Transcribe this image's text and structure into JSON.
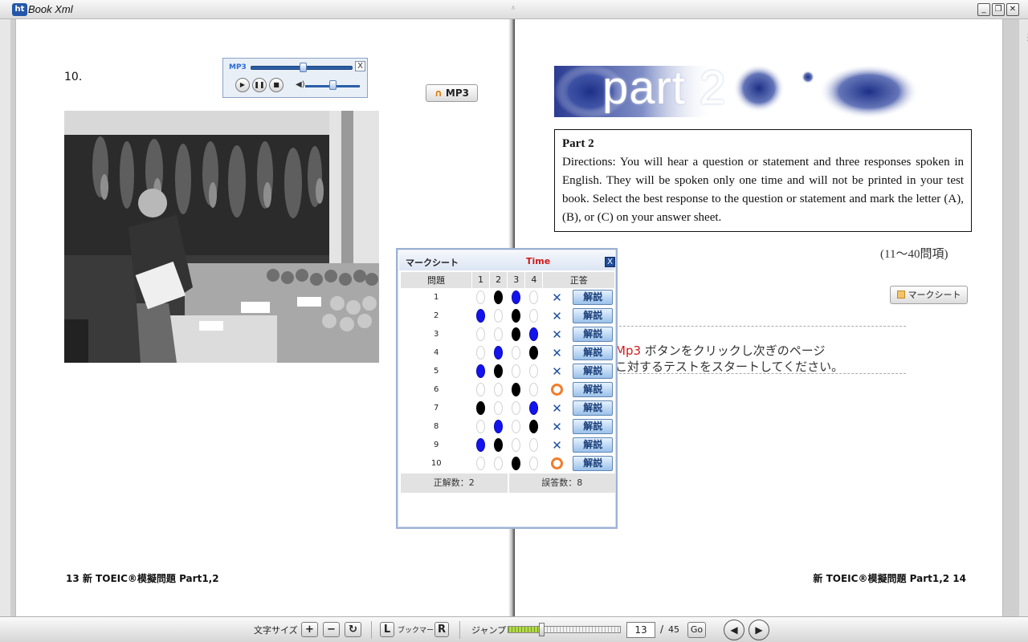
{
  "window": {
    "title": "Book Xml",
    "logo_text": "ht",
    "grip": "⩡",
    "minimize": "_",
    "restore": "❐",
    "close": "✕"
  },
  "left_page": {
    "question_number": "10.",
    "mp3_button_label": "MP3",
    "footer": "13 新 TOEIC®模擬問題 Part1,2"
  },
  "mp3_player": {
    "tag": "MP3",
    "close": "X",
    "play": "▶",
    "pause": "❚❚",
    "stop": "■",
    "volume_icon": "◀)",
    "seek_position": 0.5,
    "volume_level": 0.5
  },
  "right_page": {
    "banner_text": "part 2",
    "directions_title": "Part 2",
    "directions_text": "Directions: You will hear a question or statement and three responses spoken in English. They will be spoken only one time and will not be printed in your test book. Select the best response to the question or statement and mark the letter (A), (B), or (C) on your answer sheet.",
    "question_range": "(11～40問項)",
    "marksheet_button_label": "マークシート",
    "instruction_line1_prefix": "Mp3",
    "instruction_line1_rest": " ボタンをクリックし次ぎのページ",
    "instruction_line2": "こ対するテストをスタートしてください。",
    "footer": "新 TOEIC®模擬問題 Part1,2 14"
  },
  "marksheet": {
    "title": "マークシート",
    "time_label": "Time",
    "close": "X",
    "headers": [
      "問題",
      "1",
      "2",
      "3",
      "4",
      "正答"
    ],
    "rows": [
      {
        "num": "1",
        "marks": [
          "",
          "black",
          "blue",
          ""
        ],
        "result": "x"
      },
      {
        "num": "2",
        "marks": [
          "blue",
          "",
          "black",
          ""
        ],
        "result": "x"
      },
      {
        "num": "3",
        "marks": [
          "",
          "",
          "black",
          "blue"
        ],
        "result": "x"
      },
      {
        "num": "4",
        "marks": [
          "",
          "blue",
          "",
          "black"
        ],
        "result": "x"
      },
      {
        "num": "5",
        "marks": [
          "blue",
          "black",
          "",
          ""
        ],
        "result": "x"
      },
      {
        "num": "6",
        "marks": [
          "",
          "",
          "black",
          ""
        ],
        "result": "o"
      },
      {
        "num": "7",
        "marks": [
          "black",
          "",
          "",
          "blue"
        ],
        "result": "x"
      },
      {
        "num": "8",
        "marks": [
          "",
          "blue",
          "",
          "black"
        ],
        "result": "x"
      },
      {
        "num": "9",
        "marks": [
          "blue",
          "black",
          "",
          ""
        ],
        "result": "x"
      },
      {
        "num": "10",
        "marks": [
          "",
          "",
          "black",
          ""
        ],
        "result": "o"
      }
    ],
    "explain_label": "解説",
    "correct_count": "正解数：2",
    "wrong_count": "誤答数：8"
  },
  "bottombar": {
    "font_size_label": "文字サイズ",
    "font_plus": "+",
    "font_minus": "−",
    "font_reset": "↻",
    "bookmark_left": "L",
    "bookmark_label": "ブックマーク",
    "bookmark_right": "R",
    "jump_label": "ジャンプ",
    "jump_progress": 0.29,
    "page_current": "13",
    "page_separator": "/",
    "page_total": "45",
    "go_label": "Go",
    "prev_icon": "◀",
    "next_icon": "▶"
  }
}
